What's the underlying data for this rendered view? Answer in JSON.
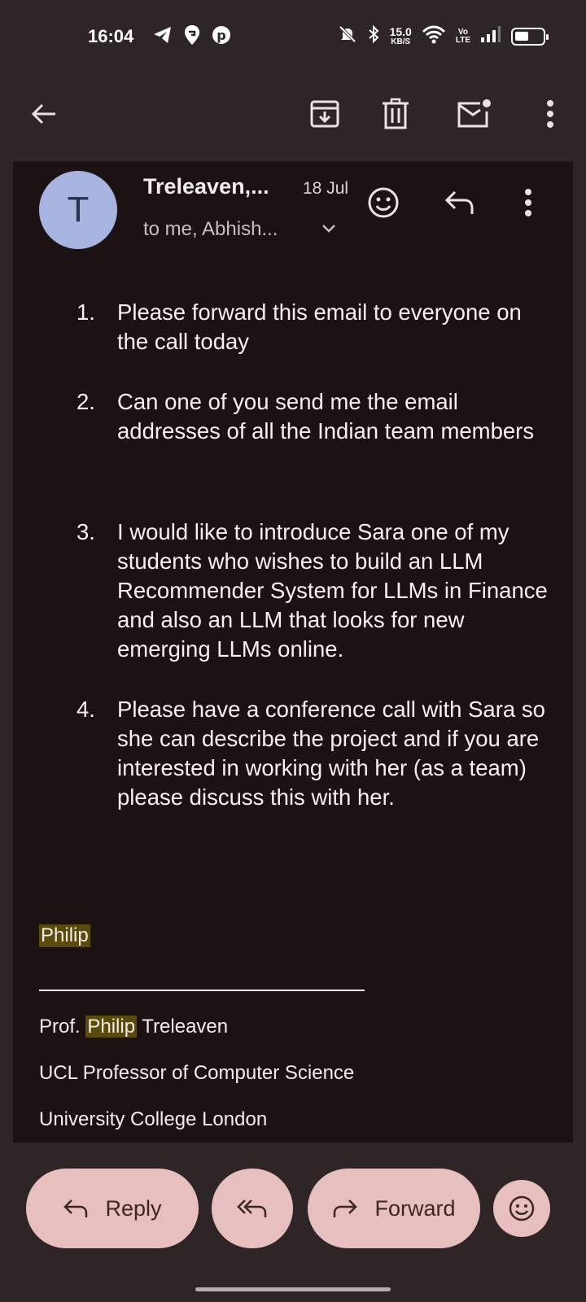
{
  "status_bar": {
    "time": "16:04",
    "net_speed_value": "15.0",
    "net_speed_unit": "KB/S",
    "volte_top": "Vo",
    "volte_bottom": "LTE",
    "left_icons": [
      "telegram-icon",
      "swiggy-icon",
      "pinterest-icon"
    ],
    "right_icons": [
      "mute-icon",
      "bluetooth-icon",
      "wifi-icon",
      "signal-icon",
      "battery-icon"
    ]
  },
  "toolbar": {
    "icons": [
      "back-arrow-icon",
      "archive-icon",
      "delete-icon",
      "mark-unread-icon",
      "more-vert-icon"
    ]
  },
  "email": {
    "avatar_letter": "T",
    "sender": "Treleaven,...",
    "date": "18 Jul",
    "recipients": "to me, Abhish...",
    "items": [
      {
        "num": "1.",
        "text": "Please forward this email to everyone on the call today"
      },
      {
        "num": "2.",
        "text": "Can one of you send me the email addresses of all the Indian team members"
      },
      {
        "num": "3.",
        "text": "I would like to introduce Sara one of my students who wishes to build an LLM Recommender System for LLMs in Finance and also an LLM that looks for new emerging LLMs online."
      },
      {
        "num": "4.",
        "text": "Please have a conference call with Sara so she can describe the project and if you are interested in working with her (as a team) please discuss this with her."
      }
    ],
    "signature": {
      "name": "Philip",
      "title_prefix": "Prof.",
      "title_highlight": "Philip",
      "title_suffix": "Treleaven",
      "role": "UCL Professor of Computer Science",
      "institution": "University College London"
    }
  },
  "actions": {
    "reply_label": "Reply",
    "forward_label": "Forward"
  },
  "colors": {
    "background": "#2e2526",
    "card": "#1c1213",
    "pill": "#e8bfbf",
    "avatar": "#a8b4e0",
    "highlight": "#5b4a08"
  }
}
